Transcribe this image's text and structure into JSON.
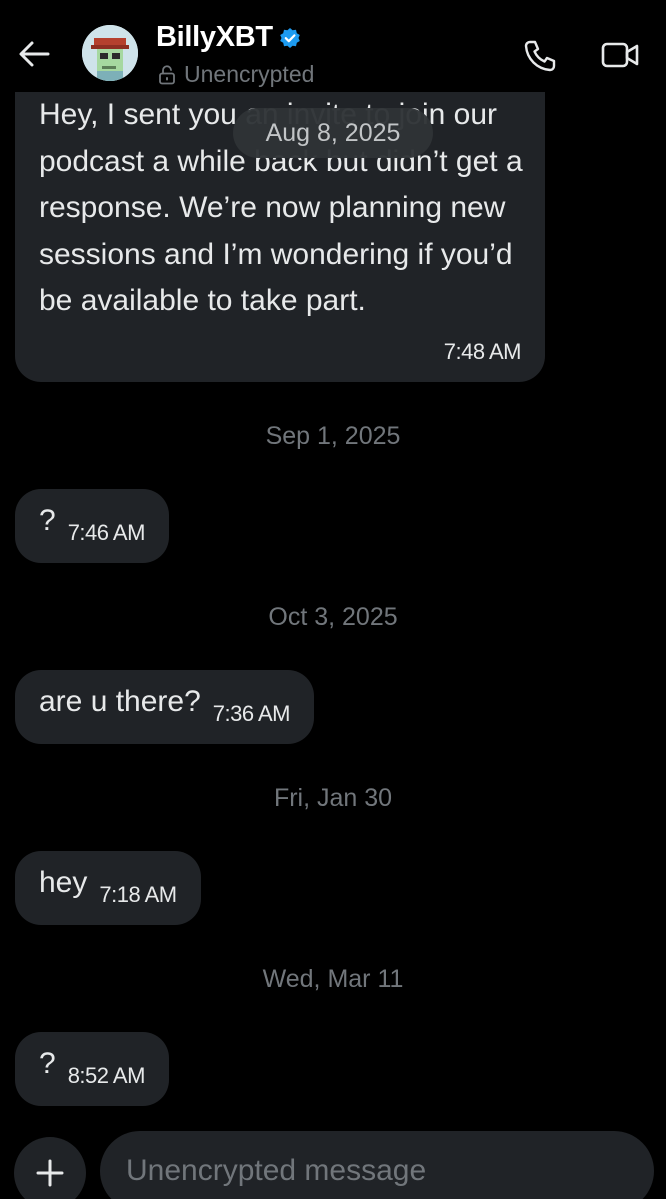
{
  "header": {
    "contact_name": "BillyXBT",
    "encryption_status": "Unencrypted",
    "icons": [
      "back-arrow-icon",
      "verified-badge-icon",
      "lock-icon",
      "phone-icon",
      "video-camera-icon"
    ]
  },
  "floating_date": "Aug 8, 2025",
  "messages": [
    {
      "text": "Hey, I sent you an invite to join our podcast a while back but didn’t get a response. We’re now planning new sessions and I’m wondering if you’d be available to take part.",
      "time": "7:48 AM"
    },
    {
      "date": "Sep 1, 2025",
      "text": "?",
      "time": "7:46 AM"
    },
    {
      "date": "Oct 3, 2025",
      "text": "are u there?",
      "time": "7:36 AM"
    },
    {
      "date": "Fri, Jan 30",
      "text": "hey",
      "time": "7:18 AM"
    },
    {
      "date": "Wed, Mar 11",
      "text": "?",
      "time": "8:52 AM"
    }
  ],
  "composer": {
    "placeholder": "Unencrypted message",
    "plus_icon": "plus-icon"
  },
  "colors": {
    "background": "#000000",
    "bubble": "#202327",
    "secondary_text": "#71767b",
    "verified": "#1d9bf0"
  }
}
